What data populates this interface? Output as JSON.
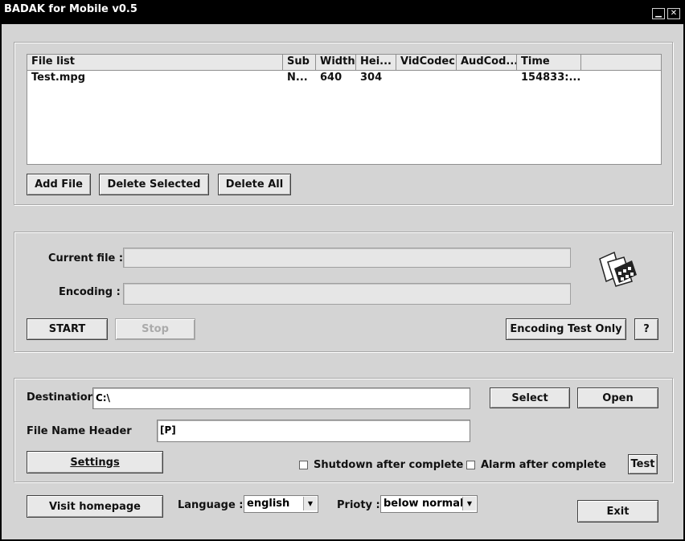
{
  "window": {
    "title": "BADAK for Mobile v0.5"
  },
  "file_list": {
    "columns": [
      "File list",
      "Sub",
      "Width",
      "Hei...",
      "VidCodec",
      "AudCod...",
      "Time"
    ],
    "rows": [
      [
        "Test.mpg",
        "N...",
        "640",
        "304",
        "",
        "",
        "154833:..."
      ]
    ],
    "buttons": {
      "add": "Add File",
      "delete_selected": "Delete Selected",
      "delete_all": "Delete All"
    }
  },
  "encode": {
    "current_file_label": "Current file :",
    "encoding_label": "Encoding :",
    "current_file_value": "",
    "encoding_value": "",
    "start": "START",
    "stop": "Stop",
    "test_only": "Encoding Test Only",
    "help": "?"
  },
  "output": {
    "destination_label": "Destinatior",
    "destination_value": "C:\\",
    "header_label": "File Name Header",
    "header_value": "[P]",
    "select": "Select",
    "open": "Open",
    "settings": "Settings",
    "shutdown_label": "Shutdown after complete",
    "alarm_label": "Alarm after complete",
    "test": "Test"
  },
  "footer": {
    "homepage": "Visit homepage",
    "language_label": "Language :",
    "language_value": "english",
    "priority_label": "Prioty :",
    "priority_value": "below normal",
    "exit": "Exit"
  }
}
